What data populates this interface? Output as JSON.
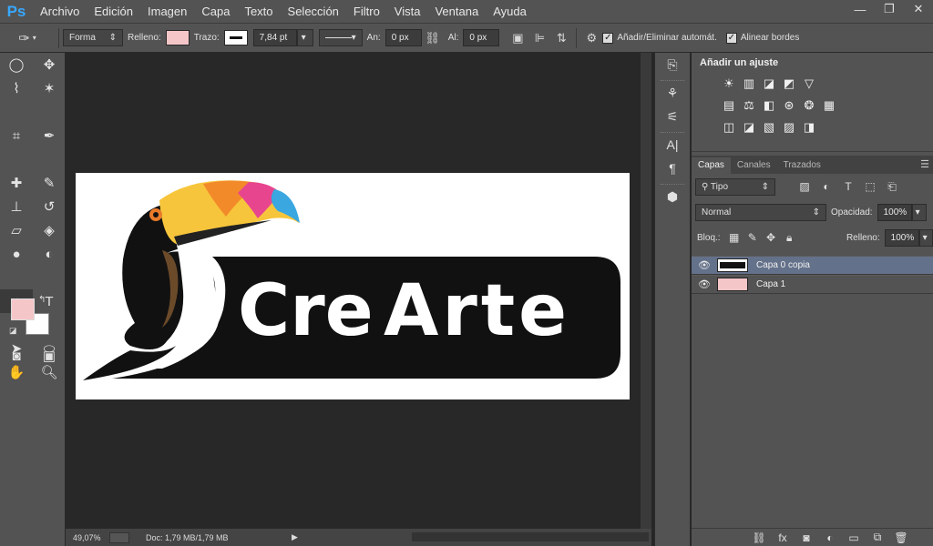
{
  "app": {
    "logo": "Ps"
  },
  "menu": [
    "Archivo",
    "Edición",
    "Imagen",
    "Capa",
    "Texto",
    "Selección",
    "Filtro",
    "Vista",
    "Ventana",
    "Ayuda"
  ],
  "window": {
    "minimize": "—",
    "restore": "❐",
    "close": "✕"
  },
  "options": {
    "mode": "Forma",
    "fill_label": "Relleno:",
    "fill_color": "#f5c6c8",
    "stroke_label": "Trazo:",
    "stroke_width": "7,84 pt",
    "width_label": "An:",
    "width_value": "0 px",
    "height_label": "Al:",
    "height_value": "0 px",
    "auto_add": "Añadir/Eliminar automát.",
    "align_edges": "Alinear bordes"
  },
  "toolbox": {
    "tools": [
      {
        "name": "marquee-icon",
        "glyph": "◯"
      },
      {
        "name": "move-icon",
        "glyph": "✥"
      },
      {
        "name": "lasso-icon",
        "glyph": "⌇"
      },
      {
        "name": "magic-wand-icon",
        "glyph": "✶"
      },
      {
        "name": "crop-icon",
        "glyph": "⌗"
      },
      {
        "name": "eyedropper-icon",
        "glyph": "✒"
      },
      {
        "name": "healing-brush-icon",
        "glyph": "✚"
      },
      {
        "name": "brush-icon",
        "glyph": "✎"
      },
      {
        "name": "clone-stamp-icon",
        "glyph": "⊥"
      },
      {
        "name": "history-brush-icon",
        "glyph": "↺"
      },
      {
        "name": "eraser-icon",
        "glyph": "▱"
      },
      {
        "name": "paint-bucket-icon",
        "glyph": "◈"
      },
      {
        "name": "blur-icon",
        "glyph": "●"
      },
      {
        "name": "dodge-icon",
        "glyph": "◐"
      },
      {
        "name": "pen-icon",
        "glyph": "✑"
      },
      {
        "name": "type-icon",
        "glyph": "T"
      },
      {
        "name": "path-selection-icon",
        "glyph": "➤"
      },
      {
        "name": "ellipse-icon",
        "glyph": "⬭"
      },
      {
        "name": "hand-icon",
        "glyph": "✋"
      },
      {
        "name": "zoom-icon",
        "glyph": "🔍︎"
      }
    ],
    "fg_color": "#f5c6c8",
    "quick_mask": "◙",
    "screen_mode": "▣"
  },
  "document": {
    "title_words": {
      "cre": "Cre",
      "arte": "Arte"
    },
    "brand_colors": {
      "beak_yellow": "#f7c53b",
      "beak_orange": "#f28a2a",
      "beak_pink": "#e8458f",
      "beak_blue": "#3aa7e0",
      "body": "#111111"
    }
  },
  "status": {
    "zoom": "49,07%",
    "doc_info": "Doc: 1,79 MB/1,79 MB"
  },
  "adjustments": {
    "title": "Añadir un ajuste",
    "row1": [
      "☀",
      "▥",
      "◪",
      "◩",
      "▽"
    ],
    "row2": [
      "▤",
      "⚖",
      "◧",
      "⊛",
      "❂",
      "▦"
    ],
    "row3": [
      "◫",
      "◪",
      "▧",
      "▨",
      "◨"
    ]
  },
  "layers_panel": {
    "tabs": [
      "Capas",
      "Canales",
      "Trazados"
    ],
    "filter_label": "⚲ Tipo",
    "blend_mode": "Normal",
    "opacity_label": "Opacidad:",
    "opacity_value": "100%",
    "lock_label": "Bloq.:",
    "fill_label": "Relleno:",
    "fill_value": "100%",
    "layers": [
      {
        "name": "Capa 0 copia",
        "selected": true
      },
      {
        "name": "Capa 1",
        "selected": false
      }
    ]
  }
}
